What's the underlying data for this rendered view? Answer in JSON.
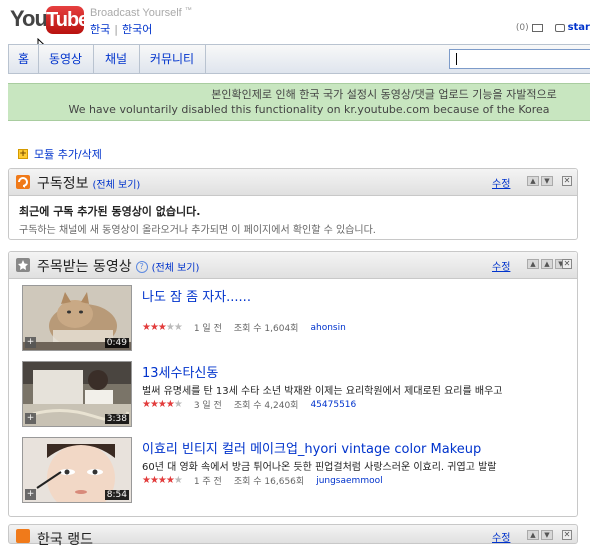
{
  "header": {
    "logo_you": "You",
    "logo_tube": "Tube",
    "tagline": "Broadcast Yourself",
    "tagline_tm": "™",
    "lang_current": "한국",
    "lang_other": "한국어",
    "inbox_count": "(0)",
    "user_label": "star"
  },
  "nav": {
    "tabs": [
      {
        "label": "홈"
      },
      {
        "label": "동영상"
      },
      {
        "label": "채널"
      },
      {
        "label": "커뮤니티"
      }
    ],
    "search_placeholder": ""
  },
  "notice": {
    "line1": "본인확인제로 인해 한국 국가 설정시 동영상/댓글 업로드 기능을 자발적으로",
    "line2": "We have voluntarily disabled this functionality on kr.youtube.com because of the Korea"
  },
  "add_module": {
    "label": "모듈 추가/삭제"
  },
  "subscriptions": {
    "title": "구독정보",
    "view_all": "(전체 보기)",
    "edit": "수정",
    "empty_title": "최근에 구독 추가된 동영상이 없습니다.",
    "empty_desc": "구독하는 채널에 새 동영상이 올라오거나 추가되면 이 페이지에서 확인할 수 있습니다."
  },
  "featured": {
    "title": "주목받는 동영상",
    "view_all": "(전체 보기)",
    "edit": "수정",
    "videos": [
      {
        "title": "나도 잠 좀 자자......",
        "desc": "",
        "duration": "0:49",
        "rating": 3.5,
        "age": "1 일 전",
        "views": "조회 수 1,604회",
        "user": "ahonsin"
      },
      {
        "title": "13세수타신동",
        "desc": "벌써 유명세를 탄 13세 수타 소년 박재완 이제는 요리학원에서 제대로된 요리를 배우고",
        "duration": "3:38",
        "rating": 4,
        "age": "3 일 전",
        "views": "조회 수 4,240회",
        "user": "45475516"
      },
      {
        "title": "이효리 빈티지 컬러 메이크업_hyori vintage color Makeup",
        "desc": "60년 대 영화 속에서 방금 튀어나온 듯한 핀업걸처럼 사랑스러운 이효리. 귀엽고 발랄",
        "duration": "8:54",
        "rating": 4,
        "age": "1 주 전",
        "views": "조회 수 16,656회",
        "user": "jungsaemmool"
      }
    ]
  },
  "bottom_module": {
    "title": "한국 랭드"
  },
  "colors": {
    "link": "#0033cc",
    "notice_bg": "#c8e6c0",
    "star": "#e23c3c"
  }
}
